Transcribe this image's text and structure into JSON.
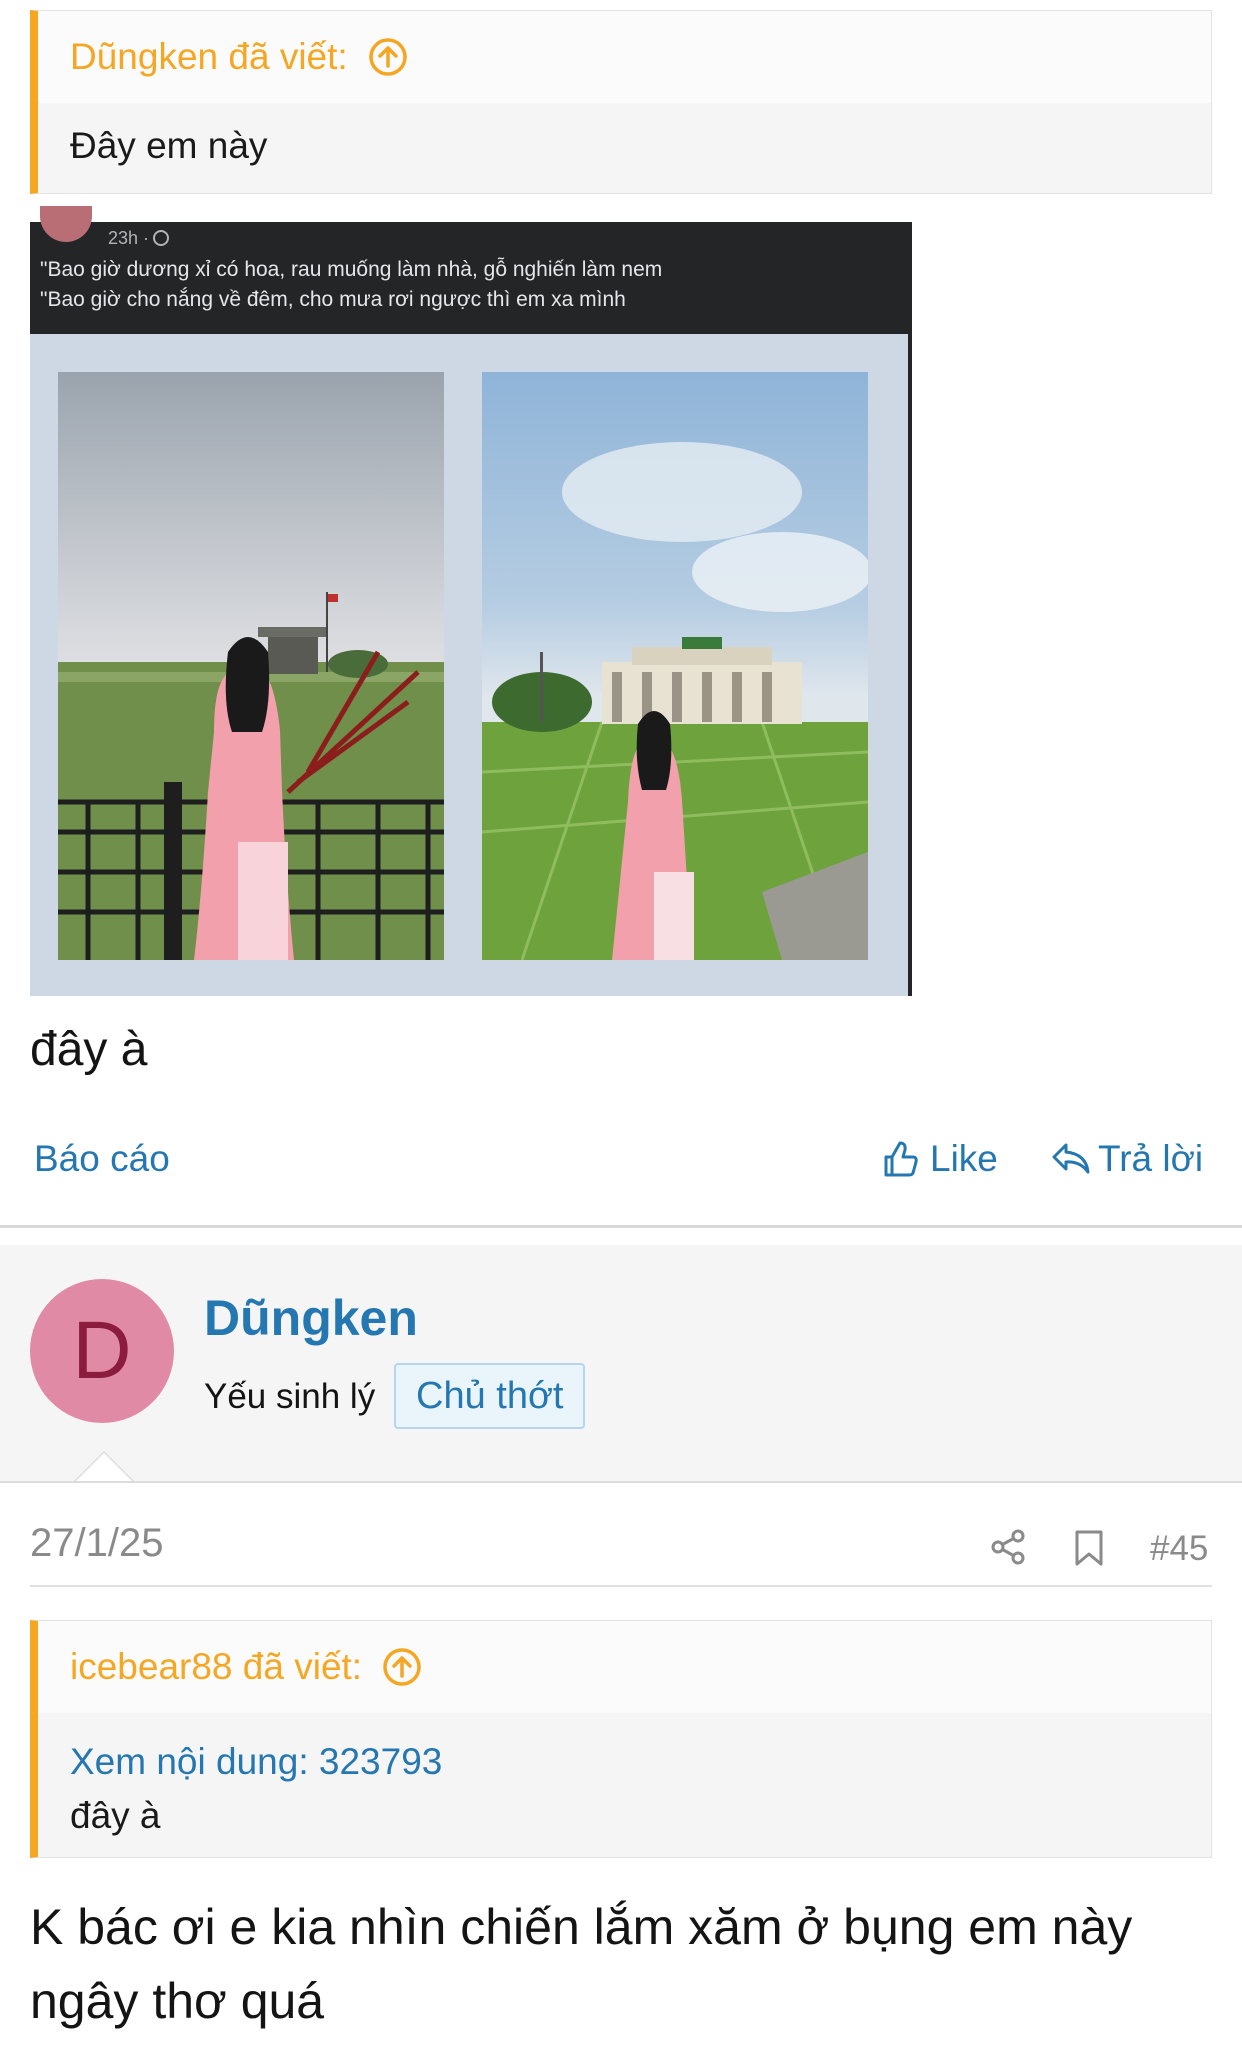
{
  "quote1": {
    "author_line": "Dũngken đã viết:",
    "body": "Đây em này"
  },
  "embedded_image": {
    "time": "23h ·",
    "line1": "\"Bao giờ dương xỉ có hoa, rau muống làm nhà, gỗ nghiến làm nem",
    "line2": "\"Bao giờ cho nắng về đêm, cho mưa rơi ngược thì em xa mình"
  },
  "post1": {
    "text": "đây à"
  },
  "actions": {
    "report": "Báo cáo",
    "like": "Like",
    "reply": "Trả lời"
  },
  "user": {
    "avatar_letter": "D",
    "name": "Dũngken",
    "title": "Yếu sinh lý",
    "badge": "Chủ thớt"
  },
  "meta": {
    "date": "27/1/25",
    "post_number": "#45"
  },
  "quote2": {
    "author_line": "icebear88 đã viết:",
    "view_link": "Xem nội dung: 323793",
    "body": "đây à"
  },
  "post2": {
    "text": "K bác ơi e kia nhìn chiến lắm xăm ở bụng em này ngây thơ quá"
  },
  "colors": {
    "accent_orange": "#f5a623",
    "link_blue": "#2577b1"
  },
  "icons": [
    "arrow-up-circle-icon",
    "thumbs-up-icon",
    "reply-icon",
    "share-icon",
    "bookmark-icon"
  ]
}
